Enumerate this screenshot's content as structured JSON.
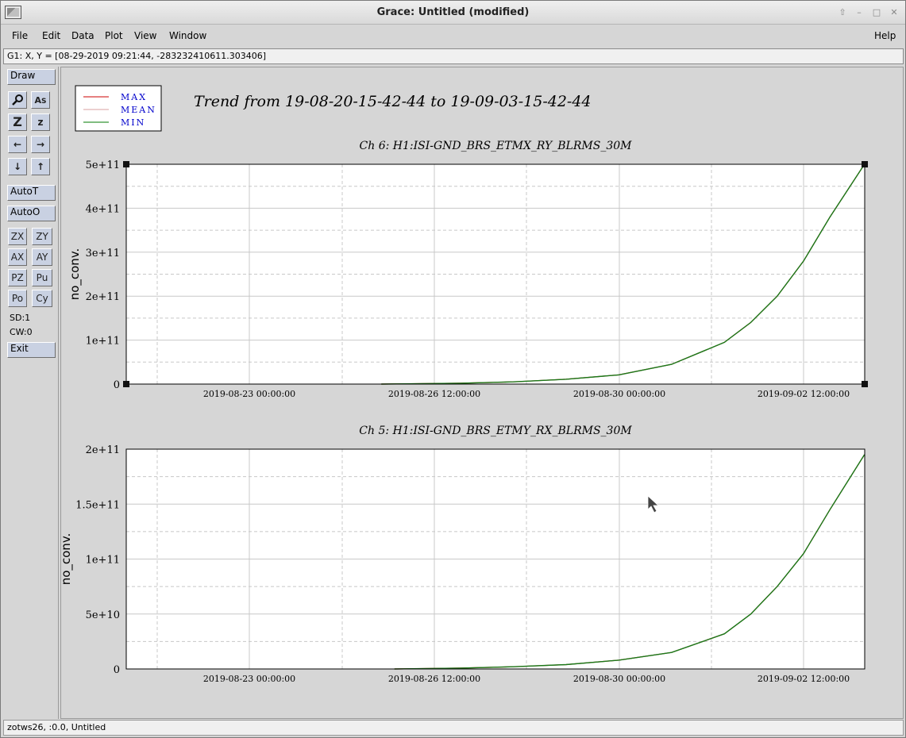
{
  "window": {
    "title": "Grace: Untitled (modified)"
  },
  "menu": {
    "file": "File",
    "edit": "Edit",
    "data": "Data",
    "plot": "Plot",
    "view": "View",
    "window": "Window",
    "help": "Help"
  },
  "locator": "G1: X, Y = [08-29-2019 09:21:44, -283232410611.303406]",
  "toolbar": {
    "draw": "Draw",
    "autot": "AutoT",
    "autoo": "AutoO",
    "zx": "ZX",
    "zy": "ZY",
    "ax": "AX",
    "ay": "AY",
    "pz": "PZ",
    "pu": "Pu",
    "po": "Po",
    "cy": "Cy",
    "sd": "SD:1",
    "cw": "CW:0",
    "exit": "Exit"
  },
  "status": "zotws26, :0.0, Untitled",
  "legend": [
    {
      "label": "MAX",
      "color": "#cc0000"
    },
    {
      "label": "MEAN",
      "color": "#d8a0a0"
    },
    {
      "label": "MIN",
      "color": "#007a00"
    }
  ],
  "colors": {
    "legend_text": "#0000cc",
    "curve": "#1a7a1a",
    "grid": "#c8c8c8"
  },
  "chart_title": "Trend from 19-08-20-15-42-44 to 19-09-03-15-42-44",
  "chart_data": [
    {
      "type": "line",
      "title": "Ch 6: H1:ISI-GND_BRS_ETMX_RY_BLRMS_30M",
      "ylabel": "no_conv.",
      "ylim": [
        0,
        500000000000
      ],
      "yticks": [
        0,
        100000000000,
        200000000000,
        300000000000,
        400000000000,
        500000000000
      ],
      "ytick_labels": [
        "0",
        "1e+11",
        "2e+11",
        "3e+11",
        "4e+11",
        "5e+11"
      ],
      "xtick_labels": [
        "2019-08-23 00:00:00",
        "2019-08-26 12:00:00",
        "2019-08-30 00:00:00",
        "2019-09-02 12:00:00"
      ],
      "series": [
        {
          "name": "MIN",
          "x": [
            "2019-08-25 12:00",
            "2019-08-27 00:00",
            "2019-08-28 00:00",
            "2019-08-29 00:00",
            "2019-08-30 00:00",
            "2019-08-31 00:00",
            "2019-09-01 00:00",
            "2019-09-01 12:00",
            "2019-09-02 00:00",
            "2019-09-02 12:00",
            "2019-09-03 00:00",
            "2019-09-03 15:42"
          ],
          "y": [
            0,
            2000000000,
            5000000000,
            11000000000,
            21000000000,
            45000000000,
            95000000000,
            140000000000,
            200000000000,
            280000000000,
            380000000000,
            500000000000
          ]
        }
      ]
    },
    {
      "type": "line",
      "title": "Ch 5: H1:ISI-GND_BRS_ETMY_RX_BLRMS_30M",
      "ylabel": "no_conv.",
      "ylim": [
        0,
        200000000000
      ],
      "yticks": [
        0,
        50000000000,
        100000000000,
        150000000000,
        200000000000
      ],
      "ytick_labels": [
        "0",
        "5e+10",
        "1e+11",
        "1.5e+11",
        "2e+11"
      ],
      "xtick_labels": [
        "2019-08-23 00:00:00",
        "2019-08-26 12:00:00",
        "2019-08-30 00:00:00",
        "2019-09-02 12:00:00"
      ],
      "series": [
        {
          "name": "MIN",
          "x": [
            "2019-08-25 18:00",
            "2019-08-27 00:00",
            "2019-08-28 00:00",
            "2019-08-29 00:00",
            "2019-08-30 00:00",
            "2019-08-31 00:00",
            "2019-09-01 00:00",
            "2019-09-01 12:00",
            "2019-09-02 00:00",
            "2019-09-02 12:00",
            "2019-09-03 00:00",
            "2019-09-03 15:42"
          ],
          "y": [
            0,
            800000000,
            2000000000,
            4000000000,
            8000000000,
            15000000000,
            32000000000,
            50000000000,
            75000000000,
            105000000000,
            145000000000,
            195000000000
          ]
        }
      ]
    }
  ]
}
